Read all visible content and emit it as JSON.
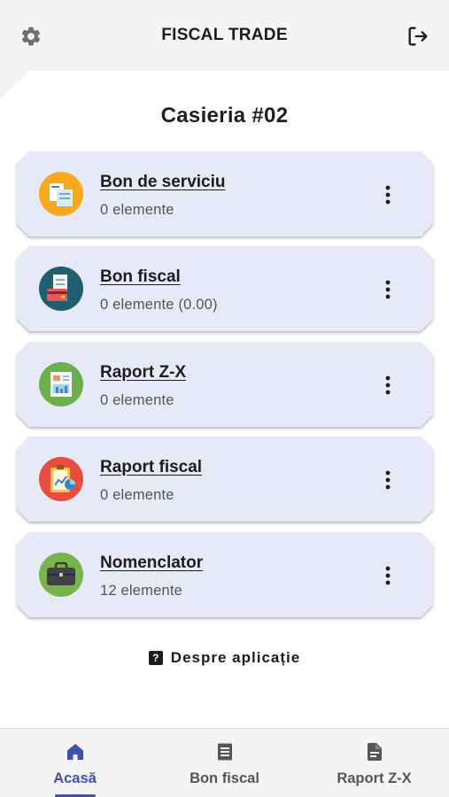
{
  "header": {
    "title": "FISCAL TRADE",
    "settings_icon": "gear-icon",
    "logout_icon": "logout-icon"
  },
  "main": {
    "title": "Casieria #02",
    "cards": [
      {
        "name": "Bon de serviciu",
        "count": "0 elemente",
        "icon": "service-receipt-icon",
        "icon_bg": "#f6a91f"
      },
      {
        "name": "Bon fiscal",
        "count": "0 elemente (0.00)",
        "icon": "fiscal-receipt-icon",
        "icon_bg": "#1f5f6f"
      },
      {
        "name": "Raport Z-X",
        "count": "0 elemente",
        "icon": "report-zx-icon",
        "icon_bg": "#6ab04c"
      },
      {
        "name": "Raport fiscal",
        "count": "0 elemente",
        "icon": "fiscal-report-icon",
        "icon_bg": "#e84c3d"
      },
      {
        "name": "Nomenclator",
        "count": "12 elemente",
        "icon": "briefcase-icon",
        "icon_bg": "#78b34b"
      }
    ],
    "about_label": "Despre aplicație"
  },
  "bottom_nav": {
    "tabs": [
      {
        "label": "Acasă",
        "icon": "home-icon",
        "active": true
      },
      {
        "label": "Bon fiscal",
        "icon": "receipt-icon",
        "active": false
      },
      {
        "label": "Raport Z-X",
        "icon": "document-icon",
        "active": false
      }
    ]
  },
  "colors": {
    "accent": "#3f4fb3",
    "card_bg": "#e8e9f6",
    "bar_bg": "#f4f4f4"
  }
}
